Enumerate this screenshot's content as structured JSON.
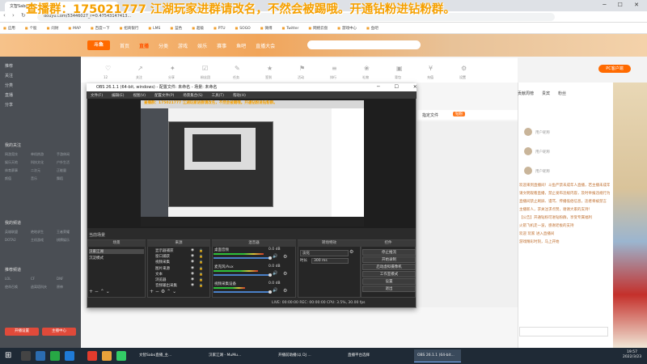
{
  "browser": {
    "tab_title": "文智Sabo直播",
    "url": "douyu.com/53446027_r=0.47543147413...",
    "bookmarks": [
      "应用",
      "个股",
      "问财",
      "MAP",
      "百度一下",
      "招商银行",
      "LMS",
      "蓝色",
      "超级",
      "PTU",
      "SOGO",
      "微博",
      "Twitter",
      "网络云盘",
      "游戏中心",
      "鱼吧"
    ]
  },
  "overlay": {
    "banner": "查播群：175021777  江湖玩家进群请改名，不然会被踢哦。开通钻粉进钻粉群。"
  },
  "site": {
    "logo": "斗鱼",
    "nav": [
      "首页",
      "直播",
      "分类",
      "游戏",
      "娱乐",
      "赛事",
      "鱼吧",
      "直播大会"
    ],
    "nav_active_index": 1,
    "pc_button": "PC客户端",
    "room_bar_labels": [
      "12",
      "关注",
      "分享",
      "粉丝团",
      "任务",
      "签到",
      "活动",
      "排行",
      "礼物",
      "背包",
      "充值",
      "设置"
    ],
    "gift_strip": "指定文件",
    "gift_badge": "钻粉"
  },
  "sidebar": {
    "items": [
      "推荐",
      "关注",
      "分类",
      "直播",
      "分享"
    ],
    "section1": "我的关注",
    "grid_rows": [
      [
        "网游竞技",
        "单机热游",
        "手游休闲"
      ],
      [
        "娱乐天地",
        "科技文化",
        "户外生活"
      ],
      [
        "体育赛事",
        "二次元",
        "正能量"
      ],
      [
        "颜值",
        "音乐",
        "舞蹈"
      ]
    ],
    "section2": "我的频道",
    "grid_rows2": [
      [
        "英雄联盟",
        "绝地求生",
        "王者荣耀"
      ],
      [
        "DOTA2",
        "主机游戏",
        "棋牌娱乐"
      ]
    ],
    "section3": "推荐频道",
    "grid_rows3": [
      [
        "LOL",
        "CF",
        "DNF"
      ],
      [
        "使命召唤",
        "逃离塔科夫",
        "原神"
      ]
    ],
    "btn_left": "开播设置",
    "btn_right": "主播中心"
  },
  "chat": {
    "tabs": [
      "贡献周榜",
      "贵宾",
      "粉丝"
    ],
    "users": [
      "用户昵称",
      "用户昵称",
      "用户昵称"
    ],
    "lines": [
      "欢迎来到直播间！斗鱼严禁未成年人直播，若主播未成年",
      "请文明观看直播，禁止发布违规内容，及时举报违规行为",
      "直播间禁止刷屏、谩骂、传播低俗信息，违者将被禁言",
      "主播新人，求关注求点赞，谢谢大家的支持！",
      "【公告】开通钻粉可进钻粉群，享受专属福利",
      "火箭飞机走一波，感谢老板的支持",
      "欢迎 玩家 进入直播间",
      "游戏精彩时刻，马上开始"
    ]
  },
  "obs": {
    "title": "OBS 26.1.1 (64-bit, windows) - 配置文件: 未命名 - 场景: 未命名",
    "menu": [
      "文件(F)",
      "编辑(E)",
      "视图(V)",
      "配置文件(P)",
      "场景集合(S)",
      "工具(T)",
      "帮助(H)"
    ],
    "scenes_label": "当前场景",
    "docks": {
      "scenes": "场景",
      "sources": "来源",
      "mixer": "混音器",
      "transitions": "转场特效",
      "controls": "控件"
    },
    "scene_items": [
      "汉家江湖",
      "沉淀模式"
    ],
    "source_items": [
      "显示器捕获",
      "窗口捕获",
      "视频采集",
      "图片来源",
      "文本",
      "浏览器",
      "音频输出采集"
    ],
    "mixer_channels": [
      {
        "name": "桌面音频",
        "db": "0.0 dB",
        "level": 0.8
      },
      {
        "name": "麦克风/Aux",
        "db": "0.0 dB",
        "level": 0.7
      },
      {
        "name": "视频采集设备",
        "db": "0.0 dB",
        "level": 0.5
      }
    ],
    "transition": "淡化",
    "duration_label": "时长",
    "duration": "300 ms",
    "control_buttons": [
      "停止推流",
      "开始录制",
      "启动虚拟摄像机",
      "工作室模式",
      "设置",
      "退出"
    ],
    "status": "LIVE: 00:00:00   REC: 00:00:00   CPU: 3.5%, 30.00 fps"
  },
  "taskbar": {
    "apps": [
      "文智Sabo直播_主...",
      "汉家江湖 - MuMu...",
      "开播前助播(以 DJ ...",
      "直播平台选择",
      "OBS 26.1.1 (64-bit..."
    ],
    "active_index": 4,
    "time": "19:57",
    "date": "2022/3/23"
  }
}
